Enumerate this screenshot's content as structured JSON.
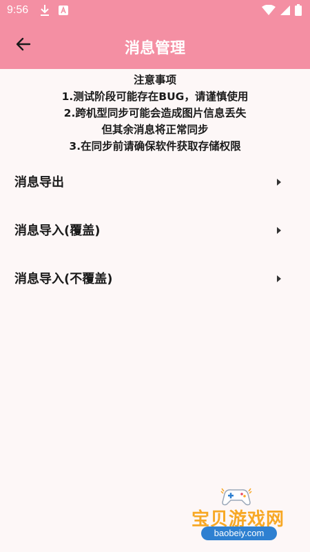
{
  "status_bar": {
    "time": "9:56",
    "left_icons": [
      "download-icon",
      "app-a-icon"
    ],
    "right_icons": [
      "wifi-icon",
      "signal-icon",
      "battery-icon"
    ]
  },
  "toolbar": {
    "title": "消息管理",
    "back_icon": "arrow-left-icon"
  },
  "notice": {
    "heading": "注意事项",
    "lines": [
      "1.测试阶段可能存在BUG，请谨慎使用",
      "2.跨机型同步可能会造成图片信息丢失",
      "但其余消息将正常同步",
      "3.在同步前请确保软件获取存储权限"
    ]
  },
  "menu": {
    "items": [
      {
        "label": "消息导出",
        "icon": "chevron-right-icon"
      },
      {
        "label": "消息导入(覆盖)",
        "icon": "chevron-right-icon"
      },
      {
        "label": "消息导入(不覆盖)",
        "icon": "chevron-right-icon"
      }
    ]
  },
  "watermark": {
    "title": "宝贝游戏网",
    "url": "baobeiy.com"
  },
  "colors": {
    "header": "#f48fa3",
    "background": "#fdf7f7",
    "watermark_orange": "#f7a825",
    "watermark_blue": "#2e80d1"
  }
}
